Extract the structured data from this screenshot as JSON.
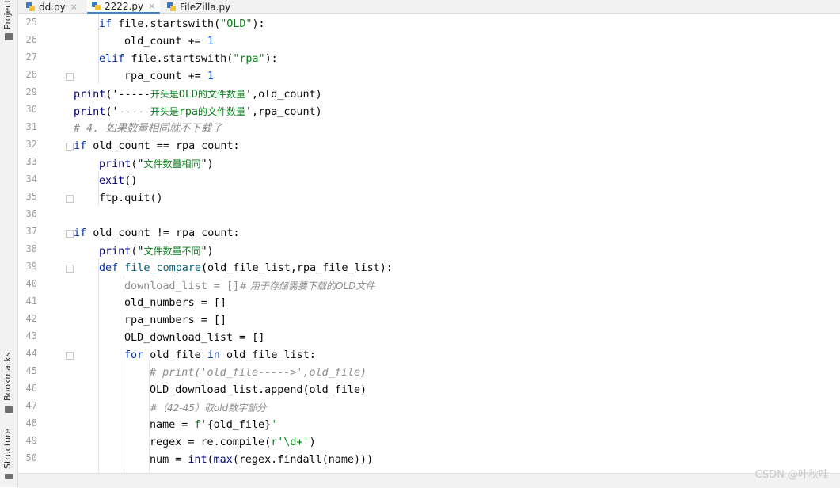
{
  "side_panel": {
    "project": "Project",
    "bookmarks": "Bookmarks",
    "structure": "Structure"
  },
  "tabs": [
    {
      "label": "dd.py"
    },
    {
      "label": "2222.py"
    },
    {
      "label": "FileZilla.py"
    }
  ],
  "tab_close": "×",
  "line_numbers": [
    "25",
    "26",
    "27",
    "28",
    "29",
    "30",
    "31",
    "32",
    "33",
    "34",
    "35",
    "36",
    "37",
    "38",
    "39",
    "40",
    "41",
    "42",
    "43",
    "44",
    "45",
    "46",
    "47",
    "48",
    "49",
    "50"
  ],
  "code": {
    "l25": [
      "if",
      "file.startswith(",
      "\"OLD\"",
      "):"
    ],
    "l26": [
      "old_count += ",
      "1"
    ],
    "l27": [
      "elif",
      "file.startswith(",
      "\"rpa\"",
      "):"
    ],
    "l28": [
      "rpa_count += ",
      "1"
    ],
    "l29": [
      "print",
      "('-----",
      "开头是",
      "OLD",
      "的文件数量",
      "',old_count)"
    ],
    "l30": [
      "print",
      "('-----",
      "开头是",
      "rpa",
      "的文件数量",
      "',rpa_count)"
    ],
    "l31": "# 4. 如果数量相同就不下载了",
    "l32": [
      "if",
      "old_count == rpa_count:"
    ],
    "l33": [
      "print",
      "(\"",
      "文件数量相同",
      "\")"
    ],
    "l34": [
      "exit",
      "()"
    ],
    "l35": "ftp.quit()",
    "l37": [
      "if",
      "old_count != rpa_count:"
    ],
    "l38": [
      "print",
      "(\"",
      "文件数量不同",
      "\")"
    ],
    "l39": [
      "def",
      "file_compare",
      "(old_file_list,rpa_file_list):"
    ],
    "l40": [
      "download_list = []",
      "# 用于存储需要下载的OLD文件"
    ],
    "l41": "old_numbers = []",
    "l42": "rpa_numbers = []",
    "l43": "OLD_download_list = []",
    "l44": [
      "for",
      "old_file",
      "in",
      "old_file_list:"
    ],
    "l45": "# print('old_file----->',old_file)",
    "l46": "OLD_download_list.append(old_file)",
    "l47": "#（42-45）取old数字部分",
    "l48": [
      "name = ",
      "f'",
      "{old_file}",
      "'"
    ],
    "l49": [
      "regex = re.compile(",
      "r'\\d+'",
      ")"
    ],
    "l50": [
      "num = ",
      "int",
      "(",
      "max",
      "(regex.findall(name)))"
    ]
  },
  "watermark": "CSDN @叶秋哇"
}
